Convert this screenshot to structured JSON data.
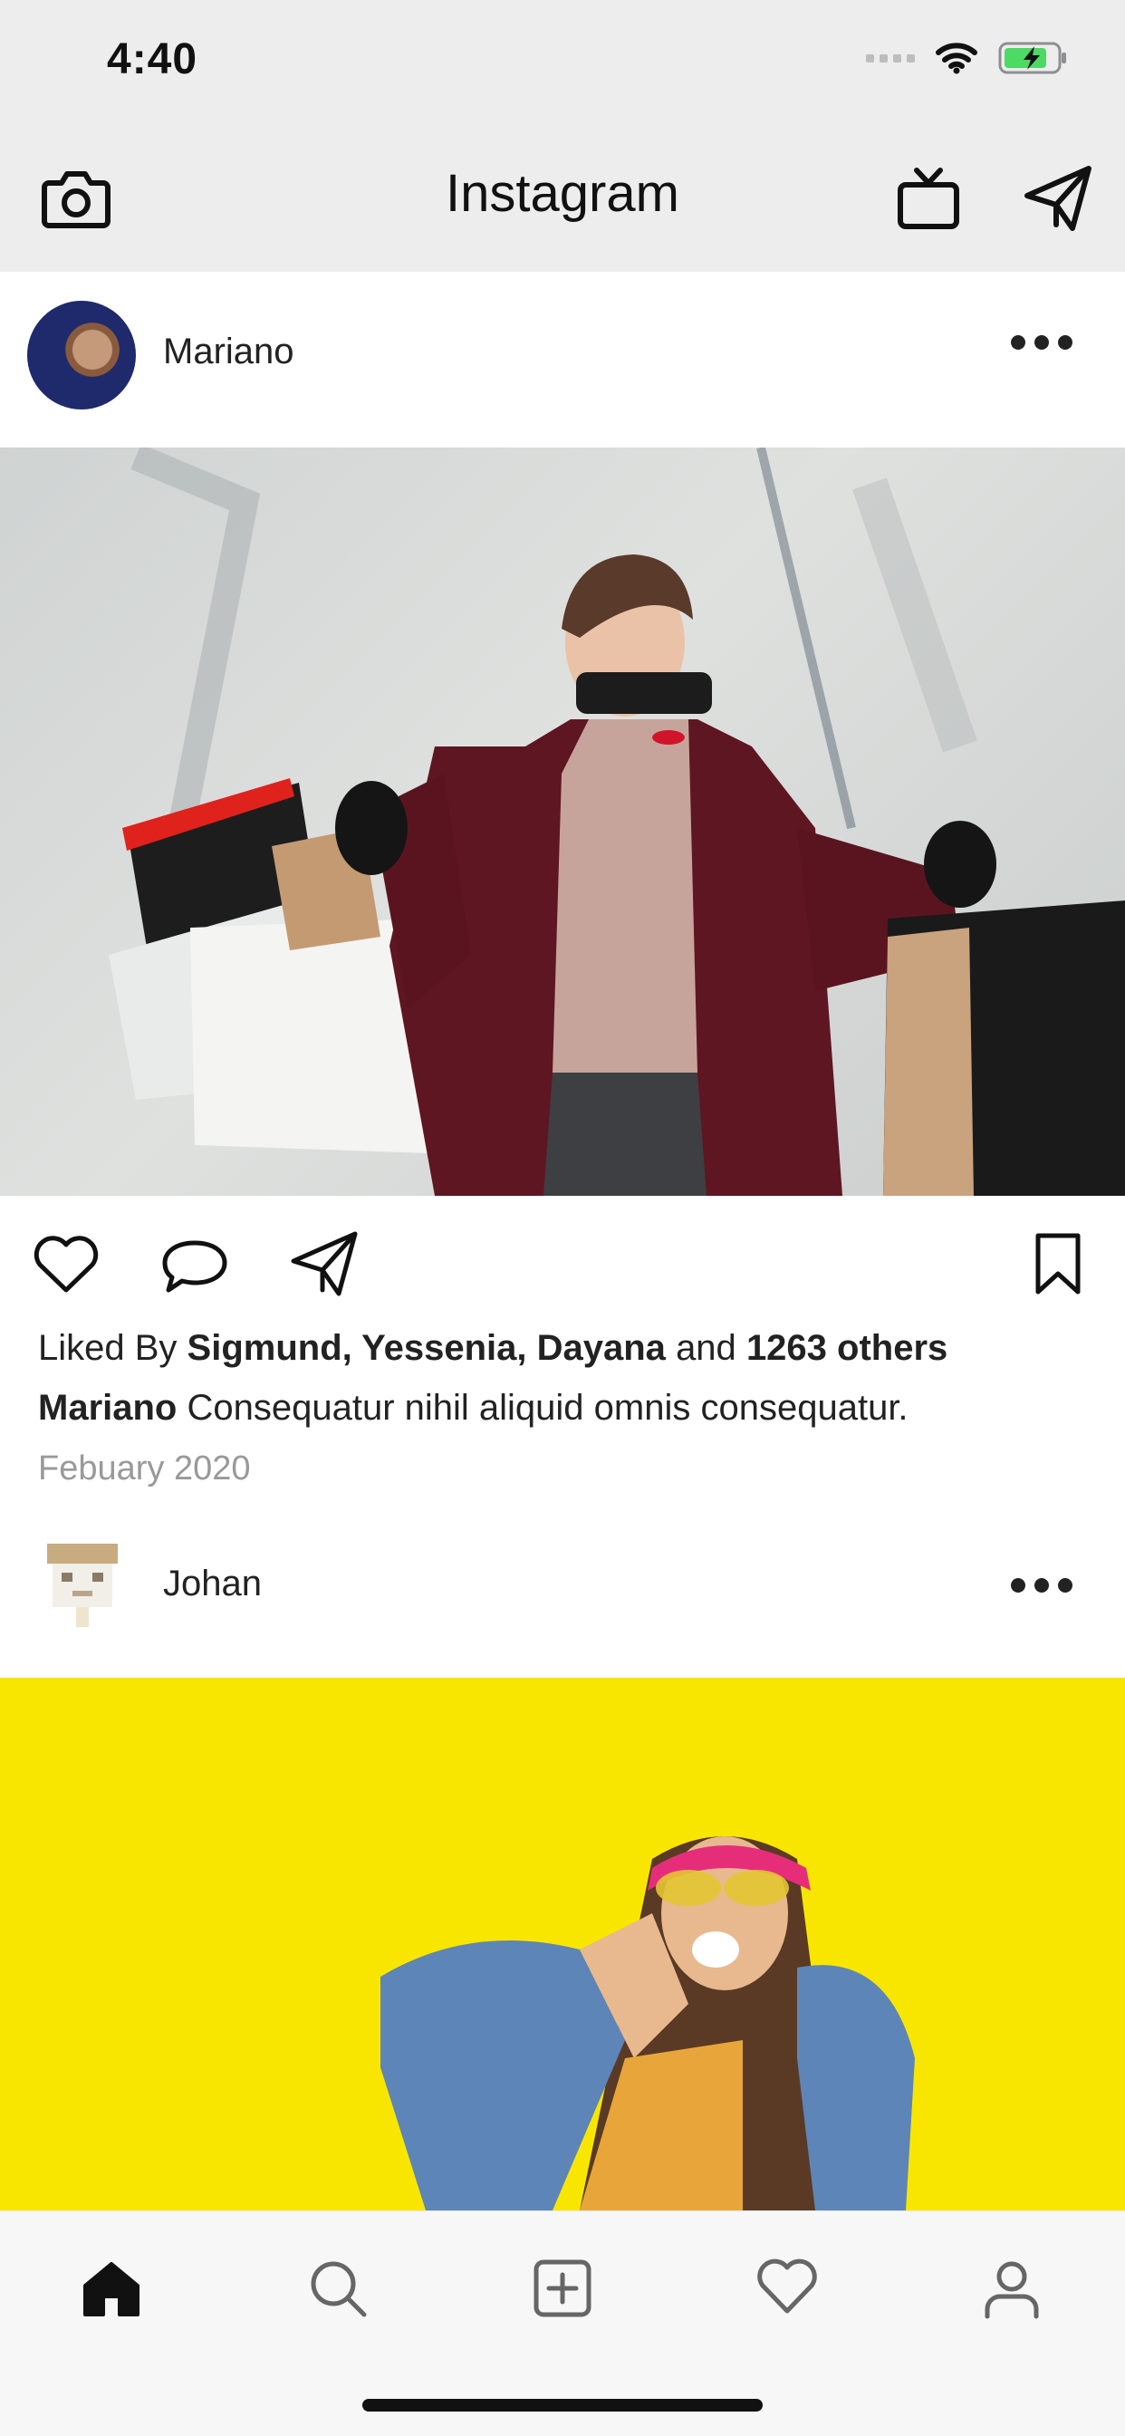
{
  "status_bar": {
    "time": "4:40"
  },
  "header": {
    "title": "Instagram"
  },
  "posts": [
    {
      "username": "Mariano",
      "liked_by_prefix": "Liked By",
      "liked_by_names": "Sigmund, Yessenia, Dayana",
      "liked_by_and": "and",
      "liked_by_others": "1263 others",
      "caption_author": "Mariano",
      "caption_text": "Consequatur nihil aliquid omnis consequatur.",
      "date": "Febuary 2020"
    },
    {
      "username": "Johan"
    }
  ],
  "colors": {
    "nav_background": "#ededed",
    "post2_background": "#f9e600",
    "battery_green": "#4cd964"
  },
  "icons": {
    "top_left": "camera-icon",
    "top_right": [
      "tv-icon",
      "paper-plane-icon"
    ],
    "post_actions": [
      "heart-icon",
      "comment-icon",
      "share-icon",
      "bookmark-icon"
    ],
    "tabs": [
      "home-icon",
      "search-icon",
      "add-icon",
      "heart-icon",
      "profile-icon"
    ]
  }
}
